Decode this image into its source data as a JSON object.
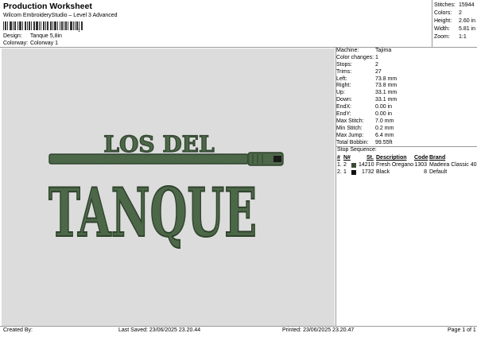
{
  "header": {
    "title": "Production Worksheet",
    "subtitle": "Wilcom EmbroideryStudio – Level 3 Advanced",
    "barcode_digit": "1",
    "design_label": "Design:",
    "design_value": "Tanque 5,8in",
    "colorway_label": "Colorway:",
    "colorway_value": "Colorway 1"
  },
  "summary": {
    "stitches_label": "Stitches:",
    "stitches": "15944",
    "colors_label": "Colors:",
    "colors": "2",
    "height_label": "Height:",
    "height": "2.60 in",
    "width_label": "Width:",
    "width": "5.81 in",
    "zoom_label": "Zoom:",
    "zoom": "1:1"
  },
  "design": {
    "line1": "LOS DEL",
    "line2": "TANQUE",
    "thread_color": "#4e6a4a",
    "outline_color": "#2f432c",
    "canvas_bg": "#dcdcdc"
  },
  "details": [
    {
      "k": "Machine:",
      "v": "Tajima"
    },
    {
      "k": "Color changes:",
      "v": "1"
    },
    {
      "k": "Stops:",
      "v": "2"
    },
    {
      "k": "Trims:",
      "v": "27"
    },
    {
      "k": "Left:",
      "v": "73.8 mm"
    },
    {
      "k": "Right:",
      "v": "73.8 mm"
    },
    {
      "k": "Up:",
      "v": "33.1 mm"
    },
    {
      "k": "Down:",
      "v": "33.1 mm"
    },
    {
      "k": "EndX:",
      "v": "0.00 in"
    },
    {
      "k": "EndY:",
      "v": "0.00 in"
    },
    {
      "k": "Max Stitch:",
      "v": "7.0 mm"
    },
    {
      "k": "Min Stitch:",
      "v": "0.2 mm"
    },
    {
      "k": "Max Jump:",
      "v": "6.4 mm"
    },
    {
      "k": "Total Bobbin:",
      "v": "99.55ft"
    }
  ],
  "stop_sequence": {
    "title": "Stop Sequence:",
    "headers": {
      "num": "#",
      "n": "N#",
      "st": "St.",
      "desc": "Description",
      "code": "Code",
      "brand": "Brand"
    },
    "rows": [
      {
        "num": "1.",
        "n": "2",
        "st": "14210",
        "desc": "Fresh Oregano",
        "code": "1303",
        "brand": "Madeira Classic 40",
        "swatch": "#3b4a36"
      },
      {
        "num": "2.",
        "n": "1",
        "st": "1732",
        "desc": "Black",
        "code": "8",
        "brand": "Default",
        "swatch": "#111111"
      }
    ]
  },
  "footer": {
    "created_by": "Created By:",
    "last_saved": "Last Saved: 23/06/2025 23.20.44",
    "printed": "Printed: 23/06/2025 23.20.47",
    "page": "Page 1 of 1"
  }
}
